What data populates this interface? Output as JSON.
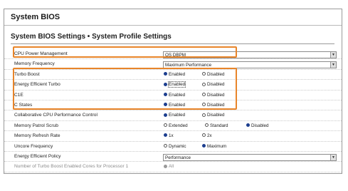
{
  "window": {
    "title": "System BIOS"
  },
  "section": {
    "title": "System BIOS Settings • System Profile Settings"
  },
  "settings": [
    {
      "label": "CPU Power Management",
      "type": "select",
      "value": "OS DBPM"
    },
    {
      "label": "Memory Frequency",
      "type": "select",
      "value": "Maximum Performance"
    },
    {
      "label": "Turbo Boost",
      "type": "radio",
      "options": [
        "Enabled",
        "Disabled"
      ],
      "selected": 0
    },
    {
      "label": "Energy Efficient Turbo",
      "type": "radio",
      "options": [
        "Enabled",
        "Disabled"
      ],
      "selected": 0,
      "focused": 0
    },
    {
      "label": "C1E",
      "type": "radio",
      "options": [
        "Enabled",
        "Disabled"
      ],
      "selected": 0
    },
    {
      "label": "C States",
      "type": "radio",
      "options": [
        "Enabled",
        "Disabled"
      ],
      "selected": 0
    },
    {
      "label": "Collaborative CPU Performance Control",
      "type": "radio",
      "options": [
        "Enabled",
        "Disabled"
      ],
      "selected": 0
    },
    {
      "label": "Memory Patrol Scrub",
      "type": "radio",
      "options": [
        "Extended",
        "Standard",
        "Disabled"
      ],
      "selected": 2
    },
    {
      "label": "Memory Refresh Rate",
      "type": "radio",
      "options": [
        "1x",
        "2x"
      ],
      "selected": 0
    },
    {
      "label": "Uncore Frequency",
      "type": "radio",
      "options": [
        "Dynamic",
        "Maximum"
      ],
      "selected": 1
    },
    {
      "label": "Energy Efficient Policy",
      "type": "select",
      "value": "Performance"
    },
    {
      "label": "Number of Turbo Boost Enabled Cores for Processor 1",
      "type": "radio",
      "options": [
        "All"
      ],
      "selected": 0,
      "disabled": true
    }
  ],
  "colors": {
    "highlight": "#e8852a",
    "radio_selected": "#1d3f8f"
  },
  "icons": {
    "dropdown": "chevron-down-icon",
    "radio": "radio-button-icon"
  }
}
